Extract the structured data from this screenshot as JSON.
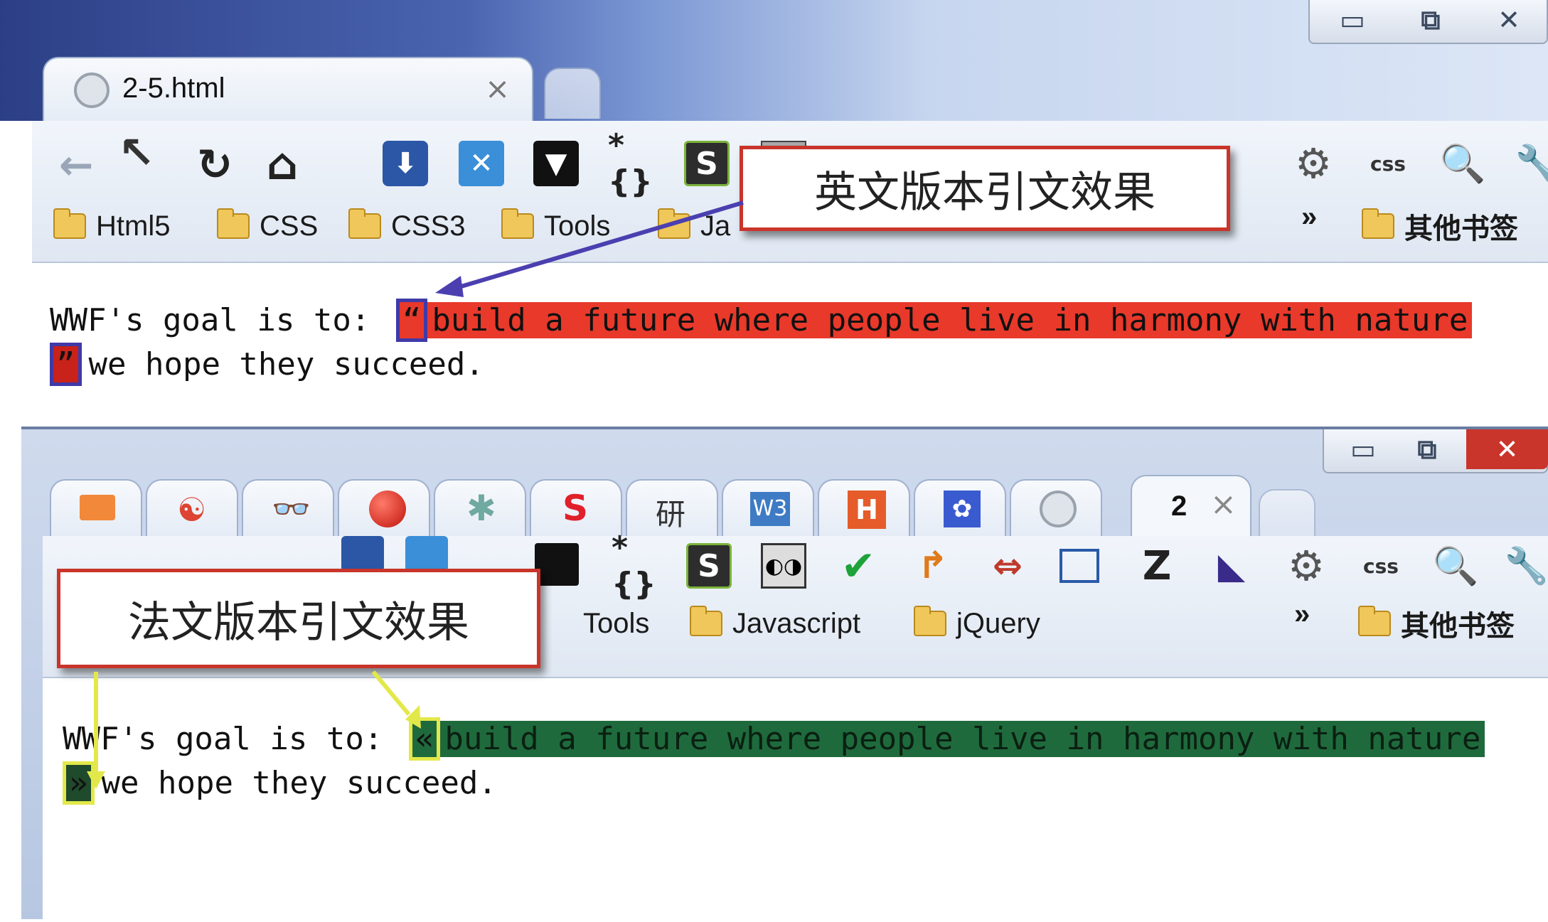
{
  "top_window": {
    "window_controls": {
      "minimize": "▭",
      "maximize": "⧉",
      "close": "✕"
    },
    "tab": {
      "title": "2-5.html",
      "close": "×"
    },
    "bookmarks": [
      {
        "label": "Html5"
      },
      {
        "label": "CSS"
      },
      {
        "label": "CSS3"
      },
      {
        "label": "Tools"
      },
      {
        "label": "Ja"
      }
    ],
    "bookmarks_more": "»",
    "other_bookmarks": "其他书签",
    "callout": "英文版本引文效果",
    "content": {
      "line1_prefix": "WWF's goal is to:",
      "quote_open": "“",
      "quote_text": "build a future where people live in harmony with nature",
      "quote_close": "”",
      "line2_text": "we hope they succeed."
    },
    "colors": {
      "quote_highlight": "#e8392a",
      "arrow": "#4b3fb0"
    }
  },
  "bottom_window": {
    "window_controls": {
      "minimize": "▭",
      "maximize": "⧉",
      "close": "✕"
    },
    "active_tab": {
      "title": "2",
      "close": "×"
    },
    "pinned_tabs": [
      "mail-icon",
      "swirl-icon",
      "glasses-icon",
      "red-ball-icon",
      "asterisk-icon",
      "s-logo-icon",
      "zh-char-icon",
      "w3-icon",
      "h-icon",
      "paw-icon",
      "globe-icon"
    ],
    "bookmarks": [
      {
        "label": "Tools"
      },
      {
        "label": "Javascript"
      },
      {
        "label": "jQuery"
      }
    ],
    "bookmarks_more": "»",
    "other_bookmarks": "其他书签",
    "callout": "法文版本引文效果",
    "content": {
      "line1_prefix": "WWF's goal is to:",
      "quote_open": "«",
      "quote_text": "build a future where people live in harmony with nature",
      "quote_close": "»",
      "line2_text": "we hope they succeed."
    },
    "colors": {
      "quote_highlight": "#1f6a3c",
      "arrow": "#e3e84a"
    }
  },
  "toolbar_icons": {
    "back": "←",
    "cursor": "↖",
    "reload": "↻",
    "home": "⌂",
    "braces": "*{}",
    "s_logo": "S",
    "z": "Z",
    "css_label": "css",
    "wrench": "🔧",
    "check": "✔"
  }
}
